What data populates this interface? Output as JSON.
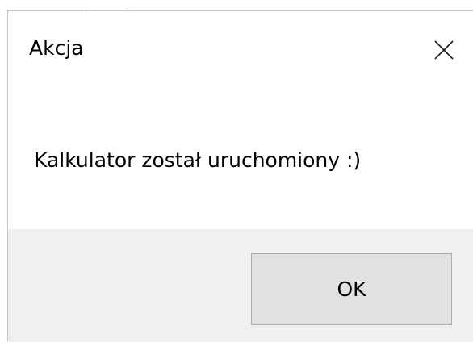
{
  "window": {
    "title": "Akcja"
  },
  "titlebar": {
    "close_icon": "close-icon"
  },
  "content": {
    "message": "Kalkulator został uruchomiony :)"
  },
  "footer": {
    "ok_label": "OK"
  },
  "colors": {
    "background": "#ffffff",
    "footer_background": "#f0f0f0",
    "button_background": "#e1e1e1",
    "button_border": "#adadad",
    "border": "#c4c4c4"
  }
}
